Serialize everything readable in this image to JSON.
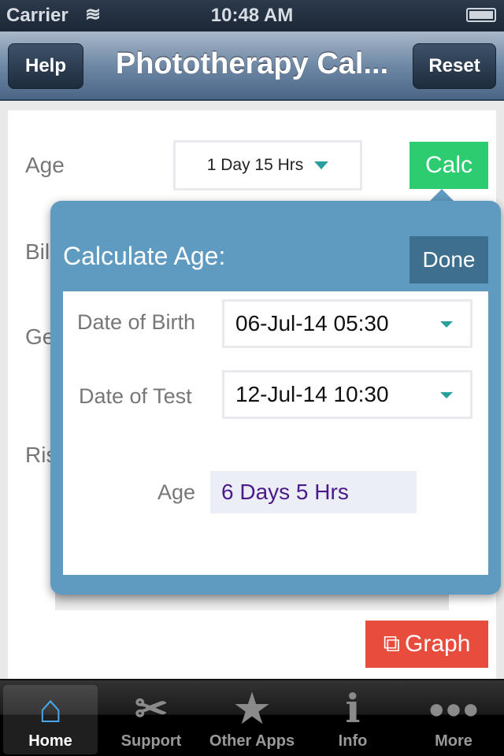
{
  "status": {
    "carrier": "Carrier",
    "time": "10:48 AM"
  },
  "nav": {
    "title": "Phototherapy Cal...",
    "help": "Help",
    "reset": "Reset"
  },
  "form": {
    "age_label": "Age",
    "age_value": "1 Day 15 Hrs",
    "calc": "Calc",
    "bili_label": "Bil",
    "ge_label": "Ge",
    "risk_label": "Ris",
    "graph": "Graph"
  },
  "popover": {
    "title": "Calculate Age:",
    "done": "Done",
    "dob_label": "Date of Birth",
    "dob_value": "06-Jul-14 05:30",
    "dot_label": "Date of Test",
    "dot_value": "12-Jul-14 10:30",
    "age_label": "Age",
    "age_value": "6 Days 5 Hrs"
  },
  "tabs": [
    {
      "label": "Home",
      "icon": "home-icon"
    },
    {
      "label": "Support",
      "icon": "tools-icon"
    },
    {
      "label": "Other Apps",
      "icon": "star-icon"
    },
    {
      "label": "Info",
      "icon": "info-icon"
    },
    {
      "label": "More",
      "icon": "more-icon"
    }
  ],
  "colors": {
    "calc": "#2ecc71",
    "graph": "#e74c3c",
    "popover": "#5f9bc0",
    "age_result": "#4b1a8a"
  }
}
